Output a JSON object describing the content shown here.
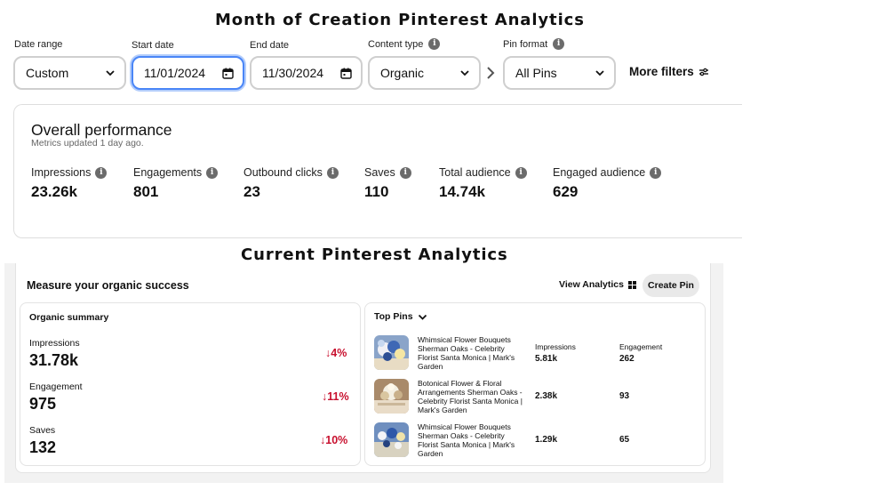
{
  "titles": {
    "month": "Month of Creation Pinterest Analytics",
    "current": "Current Pinterest Analytics"
  },
  "filters": {
    "date_range": {
      "label": "Date range",
      "value": "Custom"
    },
    "start_date": {
      "label": "Start date",
      "value": "11/01/2024"
    },
    "end_date": {
      "label": "End date",
      "value": "11/30/2024"
    },
    "content_type": {
      "label": "Content type",
      "value": "Organic"
    },
    "pin_format": {
      "label": "Pin format",
      "value": "All Pins"
    },
    "more_filters": "More filters"
  },
  "overall": {
    "title": "Overall performance",
    "subtitle": "Metrics updated 1 day ago.",
    "metrics": [
      {
        "label": "Impressions",
        "value": "23.26k"
      },
      {
        "label": "Engagements",
        "value": "801"
      },
      {
        "label": "Outbound clicks",
        "value": "23"
      },
      {
        "label": "Saves",
        "value": "110"
      },
      {
        "label": "Total audience",
        "value": "14.74k"
      },
      {
        "label": "Engaged audience",
        "value": "629"
      }
    ]
  },
  "current": {
    "heading": "Measure your organic success",
    "view_analytics": "View Analytics",
    "create_pin": "Create Pin",
    "summary": {
      "title": "Organic summary",
      "items": [
        {
          "label": "Impressions",
          "value": "31.78k",
          "change": "↓4%"
        },
        {
          "label": "Engagement",
          "value": "975",
          "change": "↓11%"
        },
        {
          "label": "Saves",
          "value": "132",
          "change": "↓10%"
        }
      ]
    },
    "top_pins": {
      "title": "Top Pins",
      "col_impressions": "Impressions",
      "col_engagement": "Engagement",
      "pins": [
        {
          "title": "Whimsical Flower Bouquets Sherman Oaks - Celebrity Florist Santa Monica | Mark's Garden",
          "impressions": "5.81k",
          "engagement": "262"
        },
        {
          "title": "Botonical Flower & Floral Arrangements Sherman Oaks - Celebrity Florist Santa Monica | Mark's Garden",
          "impressions": "2.38k",
          "engagement": "93"
        },
        {
          "title": "Whimsical Flower Bouquets Sherman Oaks - Celebrity Florist Santa Monica | Mark's Garden",
          "impressions": "1.29k",
          "engagement": "65"
        }
      ]
    }
  },
  "colors": {
    "focus": "#4a86f7",
    "negative": "#c8102e",
    "button_bg": "#e9e9e9"
  }
}
